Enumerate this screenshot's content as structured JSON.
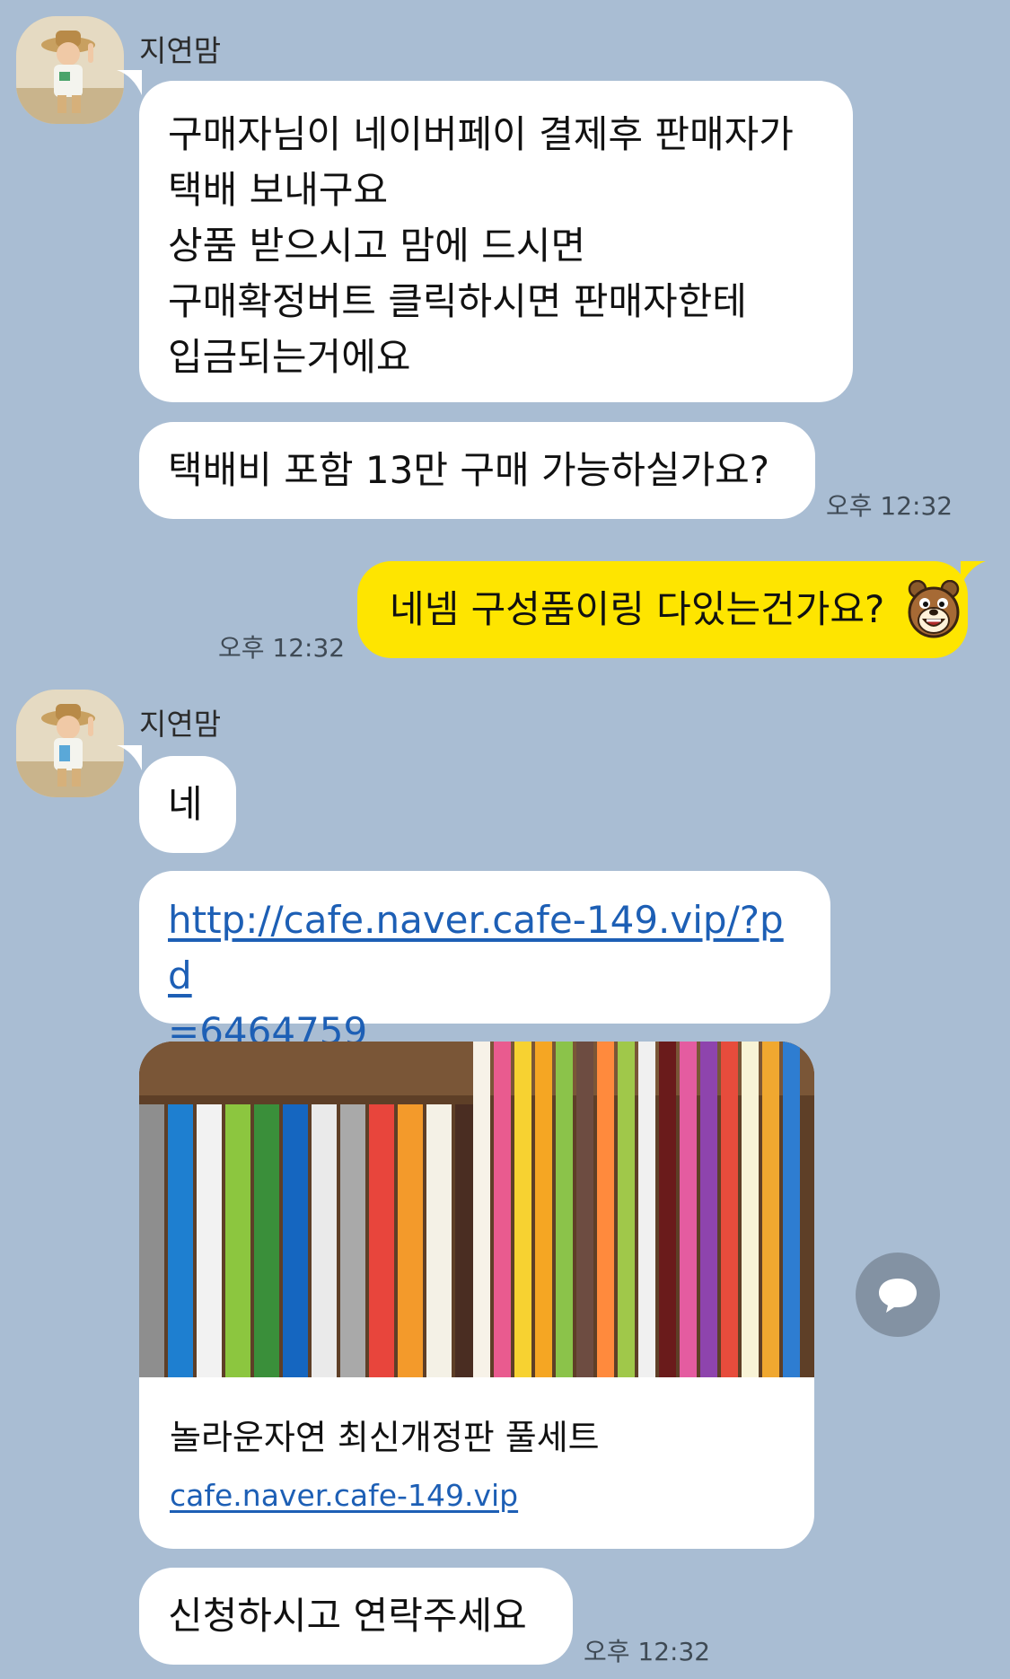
{
  "chat": {
    "sender_name_1": "지연맘",
    "sender_name_2": "지연맘",
    "messages": {
      "m1": "구매자님이 네이버페이 결제후 판매자가\n택배 보내구요\n상품 받으시고 맘에 드시면\n구매확정버트 클릭하시면 판매자한테\n입금되는거에요",
      "m2": "택배비 포함 13만 구매 가능하실가요?",
      "m2_time": "오후 12:32",
      "m3": "네넴 구성품이링 다있는건가요?",
      "m3_time": "오후 12:32",
      "m4": "네",
      "m5_link": "http://cafe.naver.cafe-149.vip/?pd\n=6464759",
      "card_title": "놀라운자연 최신개정판 풀세트",
      "card_url": "cafe.naver.cafe-149.vip",
      "m7": "신청하시고 연락주세요",
      "m7_time": "오후 12:32"
    }
  },
  "icons": {
    "avatar": "child-photo-avatar",
    "sticker": "brown-bear-emoticon",
    "share": "speech-bubble-share-icon"
  },
  "colors": {
    "background": "#a9bdd3",
    "my_bubble": "#fee500",
    "their_bubble": "#ffffff",
    "link": "#1d5fb5",
    "share_button": "#8392a3"
  }
}
